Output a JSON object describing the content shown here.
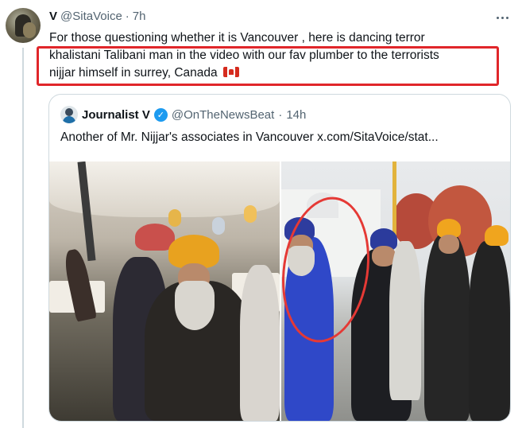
{
  "post": {
    "author_name": "V",
    "handle": "@SitaVoice",
    "separator": "·",
    "time": "7h",
    "text_lines": [
      "For those questioning whether it is Vancouver , here is dancing terror",
      "khalistani Talibani man in the video  with our fav plumber to the terrorists",
      "nijjar himself in surrey, Canada"
    ],
    "flag_icon": "canada-flag-icon",
    "highlight_color": "#e0262a"
  },
  "quote": {
    "author_name": "Journalist V",
    "handle": "@OnTheNewsBeat",
    "separator": "·",
    "time": "14h",
    "text": "Another of Mr. Nijjar's associates in Vancouver  x.com/SitaVoice/stat...",
    "verified_color": "#1d9bf0"
  },
  "icons": {
    "more": "more-options-icon",
    "verified": "verified-badge-icon"
  },
  "colors": {
    "text": "#0f1419",
    "muted": "#536471",
    "border": "#cfd9de",
    "accent": "#1d9bf0",
    "annotation_red": "#e53935"
  }
}
